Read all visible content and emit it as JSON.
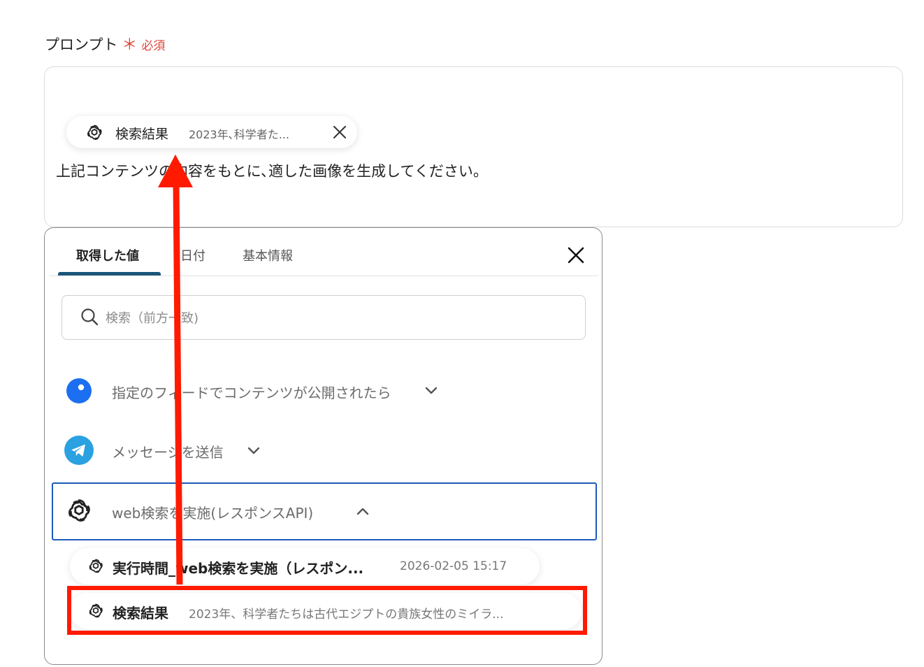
{
  "field": {
    "label": "プロンプト",
    "required_mark": "＊",
    "required_text": "必須"
  },
  "prompt": {
    "chip": {
      "icon": "openai-icon",
      "title": "検索結果",
      "value": "2023年､科学者た..."
    },
    "text": "上記コンテンツの内容をもとに､適した画像を生成してください。"
  },
  "panel": {
    "tabs": [
      {
        "label": "取得した値",
        "active": true
      },
      {
        "label": "日付",
        "active": false
      },
      {
        "label": "基本情報",
        "active": false
      }
    ],
    "search": {
      "placeholder": "検索（前方一致)",
      "value": ""
    },
    "sections": [
      {
        "icon": "feed-icon",
        "title": "指定のフィードでコンテンツが公開されたら",
        "expanded": false
      },
      {
        "icon": "telegram-icon",
        "title": "メッセージを送信",
        "expanded": false
      },
      {
        "icon": "openai-icon",
        "title": "web検索を実施(レスポンスAPI)",
        "expanded": true
      }
    ],
    "items": [
      {
        "icon": "openai-icon",
        "title": "実行時間_web検索を実施（レスポン...",
        "value": "2026-02-05 15:17"
      },
      {
        "icon": "openai-icon",
        "title": "検索結果",
        "value": "2023年、科学者たちは古代エジプトの貴族女性のミイラ..."
      }
    ]
  },
  "colors": {
    "required": "#e0453a",
    "tab_underline": "#1c5577",
    "selected_border": "#1e5bb8",
    "annotation": "#ff1a00",
    "feed_icon": "#1b6ff0",
    "telegram_icon": "#2aa1e0"
  }
}
